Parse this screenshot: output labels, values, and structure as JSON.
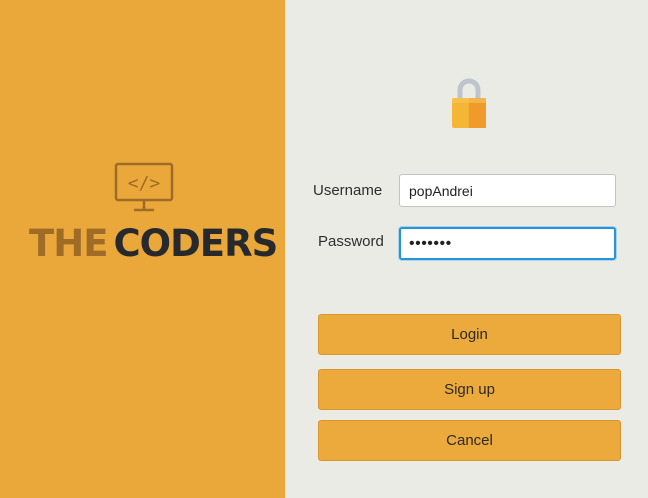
{
  "branding": {
    "logo_word_1": "THE",
    "logo_word_2": "CODERS",
    "monitor_icon_text": "</>",
    "icon": "monitor-code-icon",
    "colors": {
      "panel": "#eba83a",
      "the": "#9e6c26",
      "coders": "#27292d"
    }
  },
  "login_form": {
    "lock_icon": "padlock-icon",
    "username_label": "Username",
    "username_value": "popAndrei",
    "password_label": "Password",
    "password_value": "•••••••",
    "focus_color": "#2a93d6"
  },
  "buttons": {
    "login_label": "Login",
    "signup_label": "Sign up",
    "cancel_label": "Cancel",
    "color": "#eca93c"
  }
}
